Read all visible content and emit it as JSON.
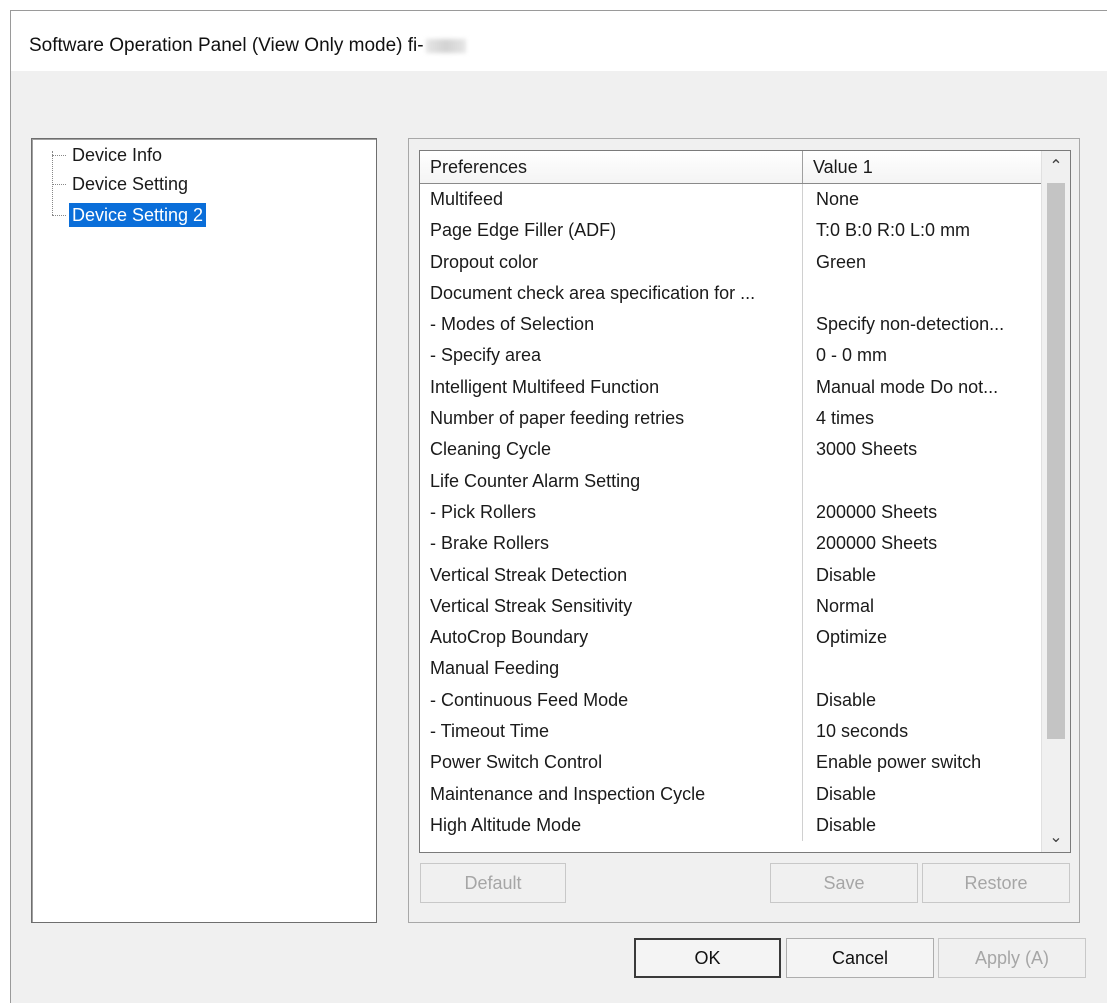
{
  "window": {
    "title": "Software Operation Panel (View Only mode) fi-"
  },
  "tree": {
    "items": [
      {
        "label": "Device Info"
      },
      {
        "label": "Device Setting"
      },
      {
        "label": "Device Setting 2"
      }
    ]
  },
  "grid": {
    "headers": {
      "preferences": "Preferences",
      "value": "Value 1"
    },
    "rows": [
      {
        "name": "Multifeed",
        "value": "None"
      },
      {
        "name": "Page Edge Filler (ADF)",
        "value": "T:0  B:0  R:0  L:0 mm"
      },
      {
        "name": "Dropout color",
        "value": "Green"
      },
      {
        "name": "Document check area specification for ...",
        "value": ""
      },
      {
        "name": " - Modes of Selection",
        "value": "Specify non-detection..."
      },
      {
        "name": " - Specify area",
        "value": "0 - 0 mm"
      },
      {
        "name": "Intelligent Multifeed Function",
        "value": "Manual mode  Do not..."
      },
      {
        "name": "Number of paper feeding retries",
        "value": "4 times"
      },
      {
        "name": "Cleaning Cycle",
        "value": "3000 Sheets"
      },
      {
        "name": "Life Counter Alarm Setting",
        "value": ""
      },
      {
        "name": " - Pick Rollers",
        "value": "200000 Sheets"
      },
      {
        "name": " - Brake Rollers",
        "value": "200000 Sheets"
      },
      {
        "name": "Vertical Streak Detection",
        "value": "Disable"
      },
      {
        "name": "Vertical Streak Sensitivity",
        "value": "Normal"
      },
      {
        "name": "AutoCrop Boundary",
        "value": "Optimize"
      },
      {
        "name": "Manual Feeding",
        "value": ""
      },
      {
        "name": " - Continuous Feed Mode",
        "value": "Disable"
      },
      {
        "name": " - Timeout Time",
        "value": "10 seconds"
      },
      {
        "name": "Power Switch Control",
        "value": "Enable power switch"
      },
      {
        "name": "Maintenance and Inspection Cycle",
        "value": "Disable"
      },
      {
        "name": "High Altitude Mode",
        "value": "Disable"
      }
    ]
  },
  "panel_buttons": {
    "default": "Default",
    "save": "Save",
    "restore": "Restore"
  },
  "dialog_buttons": {
    "ok": "OK",
    "cancel": "Cancel",
    "apply": "Apply (A)"
  }
}
